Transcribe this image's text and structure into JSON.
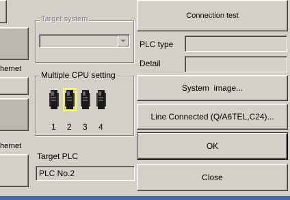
{
  "left_edge": {
    "label_top": "hernet",
    "label_bottom": "hernet"
  },
  "target_system": {
    "legend": "Target system",
    "value": ""
  },
  "multiple_cpu": {
    "legend": "Multiple CPU setting",
    "cpu_numbers": [
      "1",
      "2",
      "3",
      "4"
    ],
    "selected_index": 1
  },
  "target_plc": {
    "label": "Target PLC",
    "value": "PLC No.2"
  },
  "right_panel": {
    "connection_test": "Connection test",
    "plc_type_label": "PLC type",
    "plc_type_value": "",
    "detail_label": "Detail",
    "detail_value": "",
    "system_image": "System  image...",
    "line_connected": "Line Connected (Q/A6TEL,C24)...",
    "ok": "OK",
    "close": "Close"
  },
  "colors": {
    "face": "#d4d0c8",
    "cpu_body": "#1a1a1a",
    "cpu_highlight": "#ffff40",
    "bottom_bar": "#4a6aa5"
  }
}
